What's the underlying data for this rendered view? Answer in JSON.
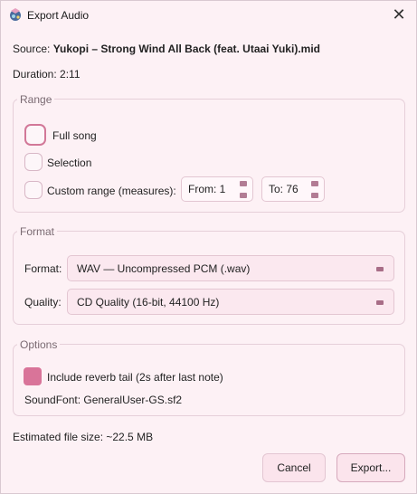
{
  "window": {
    "title": "Export Audio",
    "close_glyph": "✕"
  },
  "info": {
    "source_label": "Source:",
    "source_value": "Yukopi – Strong Wind All Back (feat. Utaai Yuki).mid",
    "duration": "Duration: 2:11"
  },
  "range": {
    "title": "Range",
    "full_song": "Full song",
    "selection": "Selection",
    "custom": "Custom range (measures):",
    "from": "From: 1",
    "to": "To: 76",
    "selected": "full_song"
  },
  "format": {
    "title": "Format",
    "format_label": "Format:",
    "format_value": "WAV — Uncompressed PCM (.wav)",
    "quality_label": "Quality:",
    "quality_value": "CD Quality (16-bit, 44100 Hz)"
  },
  "options": {
    "title": "Options",
    "reverb_label": "Include reverb tail (2s after last note)",
    "reverb_checked": true,
    "soundfont": "SoundFont: GeneralUser-GS.sf2"
  },
  "estimate": "Estimated file size: ~22.5 MB",
  "buttons": {
    "cancel": "Cancel",
    "export": "Export..."
  },
  "colors": {
    "accent": "#d97499",
    "background": "#fdf1f5"
  }
}
